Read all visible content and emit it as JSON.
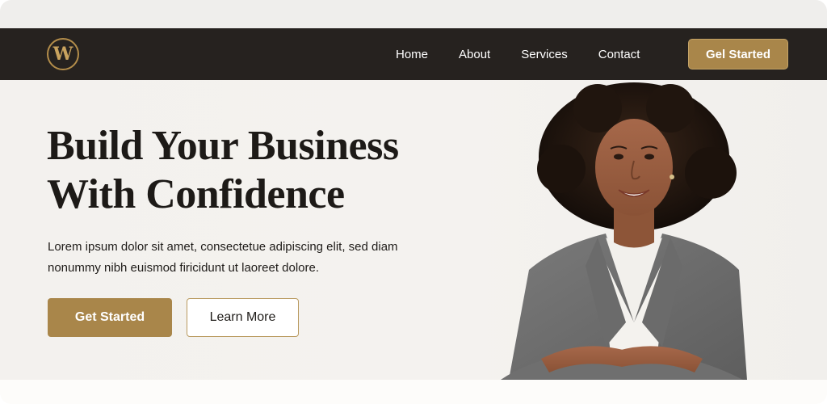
{
  "brand": {
    "logo_letter": "W",
    "accent_color": "#a9864a",
    "nav_bg": "#26221f"
  },
  "nav": {
    "links": [
      {
        "label": "Home"
      },
      {
        "label": "About"
      },
      {
        "label": "Services"
      },
      {
        "label": "Contact"
      }
    ],
    "cta_label": "Gel Started"
  },
  "hero": {
    "headline_line1": "Build Your Business",
    "headline_line2": "With Confidence",
    "paragraph": "Lorem ipsum dolor sit amet, consectetue adipiscing elit, sed diam nonummy nibh euismod firicidunt ut laoreet dolore.",
    "primary_button": "Get Started",
    "secondary_button": "Learn More",
    "image_subject": "smiling businesswoman in gray blazer with arms crossed"
  }
}
